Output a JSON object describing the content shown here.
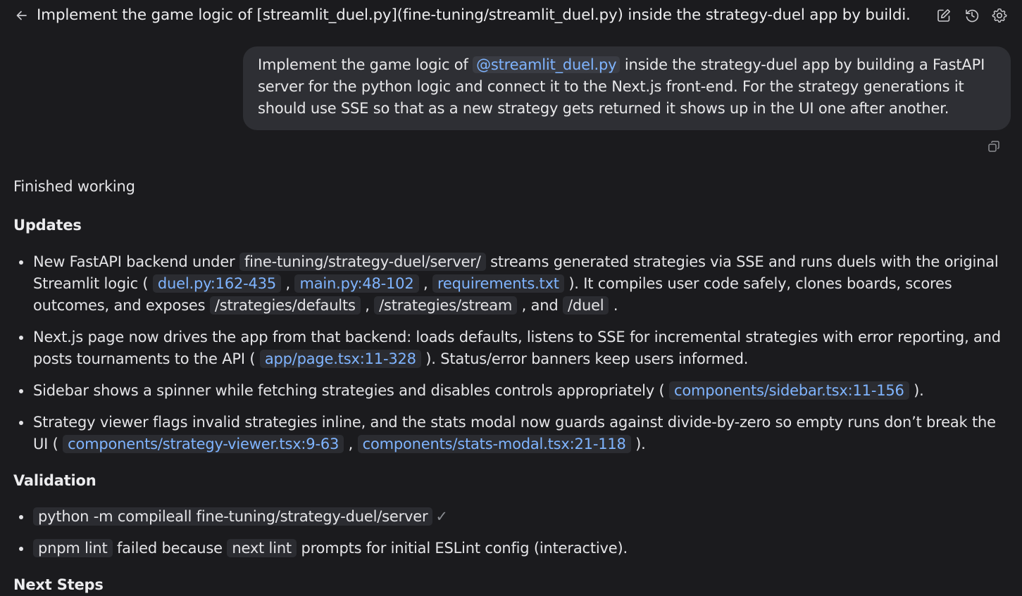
{
  "header": {
    "title": "Implement the game logic of [streamlit_duel.py](fine-tuning/streamlit_duel.py) inside the strategy-duel app by buildi...",
    "back_icon": "arrow-left-icon",
    "actions": [
      {
        "name": "edit-icon"
      },
      {
        "name": "history-icon"
      },
      {
        "name": "settings-gear-icon"
      }
    ]
  },
  "user_message": {
    "part1": "Implement the game logic of ",
    "mention": "@streamlit_duel.py",
    "part2": " inside the strategy-duel app by building a FastAPI server for the python logic and connect it to the Next.js front-end. For the strategy generations it should use SSE so that as a new strategy gets returned it shows up in the UI one after another."
  },
  "response": {
    "status": "Finished working",
    "updates_heading": "Updates",
    "updates": {
      "b1": {
        "t1": "New FastAPI backend under ",
        "c1": "fine-tuning/strategy-duel/server/",
        "t2": " streams generated strategies via SSE and runs duels with the original Streamlit logic ( ",
        "l1": "duel.py:162-435",
        "t3": " , ",
        "l2": "main.py:48-102",
        "t4": " , ",
        "l3": "requirements.txt",
        "t5": " ). It compiles user code safely, clones boards, scores outcomes, and exposes ",
        "c2": "/strategies/defaults",
        "t6": " , ",
        "c3": "/strategies/stream",
        "t7": " , and ",
        "c4": "/duel",
        "t8": " ."
      },
      "b2": {
        "t1": "Next.js page now drives the app from that backend: loads defaults, listens to SSE for incremental strategies with error reporting, and posts tournaments to the API ( ",
        "l1": "app/page.tsx:11-328",
        "t2": " ). Status/error banners keep users informed."
      },
      "b3": {
        "t1": "Sidebar shows a spinner while fetching strategies and disables controls appropriately ( ",
        "l1": "components/sidebar.tsx:11-156",
        "t2": " )."
      },
      "b4": {
        "t1": "Strategy viewer flags invalid strategies inline, and the stats modal now guards against divide-by-zero so empty runs don’t break the UI ( ",
        "l1": "components/strategy-viewer.tsx:9-63",
        "t2": " , ",
        "l2": "components/stats-modal.tsx:21-118",
        "t3": " )."
      }
    },
    "validation_heading": "Validation",
    "validation": {
      "v1": {
        "c1": "python -m compileall fine-tuning/strategy-duel/server",
        "check": "✓"
      },
      "v2": {
        "c1": "pnpm lint",
        "t1": " failed because ",
        "c2": "next lint",
        "t2": " prompts for initial ESLint config (interactive)."
      }
    },
    "next_steps_heading": "Next Steps"
  }
}
